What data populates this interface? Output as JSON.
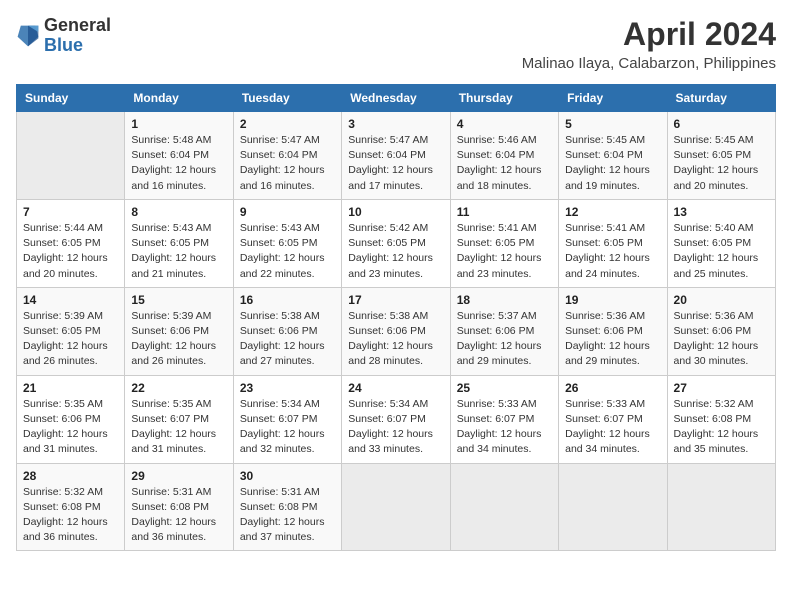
{
  "header": {
    "logo": {
      "line1": "General",
      "line2": "Blue"
    },
    "title": "April 2024",
    "subtitle": "Malinao Ilaya, Calabarzon, Philippines"
  },
  "weekdays": [
    "Sunday",
    "Monday",
    "Tuesday",
    "Wednesday",
    "Thursday",
    "Friday",
    "Saturday"
  ],
  "weeks": [
    [
      null,
      {
        "day": "1",
        "sunrise": "5:48 AM",
        "sunset": "6:04 PM",
        "daylight": "12 hours and 16 minutes."
      },
      {
        "day": "2",
        "sunrise": "5:47 AM",
        "sunset": "6:04 PM",
        "daylight": "12 hours and 16 minutes."
      },
      {
        "day": "3",
        "sunrise": "5:47 AM",
        "sunset": "6:04 PM",
        "daylight": "12 hours and 17 minutes."
      },
      {
        "day": "4",
        "sunrise": "5:46 AM",
        "sunset": "6:04 PM",
        "daylight": "12 hours and 18 minutes."
      },
      {
        "day": "5",
        "sunrise": "5:45 AM",
        "sunset": "6:04 PM",
        "daylight": "12 hours and 19 minutes."
      },
      {
        "day": "6",
        "sunrise": "5:45 AM",
        "sunset": "6:05 PM",
        "daylight": "12 hours and 20 minutes."
      }
    ],
    [
      {
        "day": "7",
        "sunrise": "5:44 AM",
        "sunset": "6:05 PM",
        "daylight": "12 hours and 20 minutes."
      },
      {
        "day": "8",
        "sunrise": "5:43 AM",
        "sunset": "6:05 PM",
        "daylight": "12 hours and 21 minutes."
      },
      {
        "day": "9",
        "sunrise": "5:43 AM",
        "sunset": "6:05 PM",
        "daylight": "12 hours and 22 minutes."
      },
      {
        "day": "10",
        "sunrise": "5:42 AM",
        "sunset": "6:05 PM",
        "daylight": "12 hours and 23 minutes."
      },
      {
        "day": "11",
        "sunrise": "5:41 AM",
        "sunset": "6:05 PM",
        "daylight": "12 hours and 23 minutes."
      },
      {
        "day": "12",
        "sunrise": "5:41 AM",
        "sunset": "6:05 PM",
        "daylight": "12 hours and 24 minutes."
      },
      {
        "day": "13",
        "sunrise": "5:40 AM",
        "sunset": "6:05 PM",
        "daylight": "12 hours and 25 minutes."
      }
    ],
    [
      {
        "day": "14",
        "sunrise": "5:39 AM",
        "sunset": "6:05 PM",
        "daylight": "12 hours and 26 minutes."
      },
      {
        "day": "15",
        "sunrise": "5:39 AM",
        "sunset": "6:06 PM",
        "daylight": "12 hours and 26 minutes."
      },
      {
        "day": "16",
        "sunrise": "5:38 AM",
        "sunset": "6:06 PM",
        "daylight": "12 hours and 27 minutes."
      },
      {
        "day": "17",
        "sunrise": "5:38 AM",
        "sunset": "6:06 PM",
        "daylight": "12 hours and 28 minutes."
      },
      {
        "day": "18",
        "sunrise": "5:37 AM",
        "sunset": "6:06 PM",
        "daylight": "12 hours and 29 minutes."
      },
      {
        "day": "19",
        "sunrise": "5:36 AM",
        "sunset": "6:06 PM",
        "daylight": "12 hours and 29 minutes."
      },
      {
        "day": "20",
        "sunrise": "5:36 AM",
        "sunset": "6:06 PM",
        "daylight": "12 hours and 30 minutes."
      }
    ],
    [
      {
        "day": "21",
        "sunrise": "5:35 AM",
        "sunset": "6:06 PM",
        "daylight": "12 hours and 31 minutes."
      },
      {
        "day": "22",
        "sunrise": "5:35 AM",
        "sunset": "6:07 PM",
        "daylight": "12 hours and 31 minutes."
      },
      {
        "day": "23",
        "sunrise": "5:34 AM",
        "sunset": "6:07 PM",
        "daylight": "12 hours and 32 minutes."
      },
      {
        "day": "24",
        "sunrise": "5:34 AM",
        "sunset": "6:07 PM",
        "daylight": "12 hours and 33 minutes."
      },
      {
        "day": "25",
        "sunrise": "5:33 AM",
        "sunset": "6:07 PM",
        "daylight": "12 hours and 34 minutes."
      },
      {
        "day": "26",
        "sunrise": "5:33 AM",
        "sunset": "6:07 PM",
        "daylight": "12 hours and 34 minutes."
      },
      {
        "day": "27",
        "sunrise": "5:32 AM",
        "sunset": "6:08 PM",
        "daylight": "12 hours and 35 minutes."
      }
    ],
    [
      {
        "day": "28",
        "sunrise": "5:32 AM",
        "sunset": "6:08 PM",
        "daylight": "12 hours and 36 minutes."
      },
      {
        "day": "29",
        "sunrise": "5:31 AM",
        "sunset": "6:08 PM",
        "daylight": "12 hours and 36 minutes."
      },
      {
        "day": "30",
        "sunrise": "5:31 AM",
        "sunset": "6:08 PM",
        "daylight": "12 hours and 37 minutes."
      },
      null,
      null,
      null,
      null
    ]
  ],
  "labels": {
    "sunrise_prefix": "Sunrise: ",
    "sunset_prefix": "Sunset: ",
    "daylight_prefix": "Daylight: "
  }
}
